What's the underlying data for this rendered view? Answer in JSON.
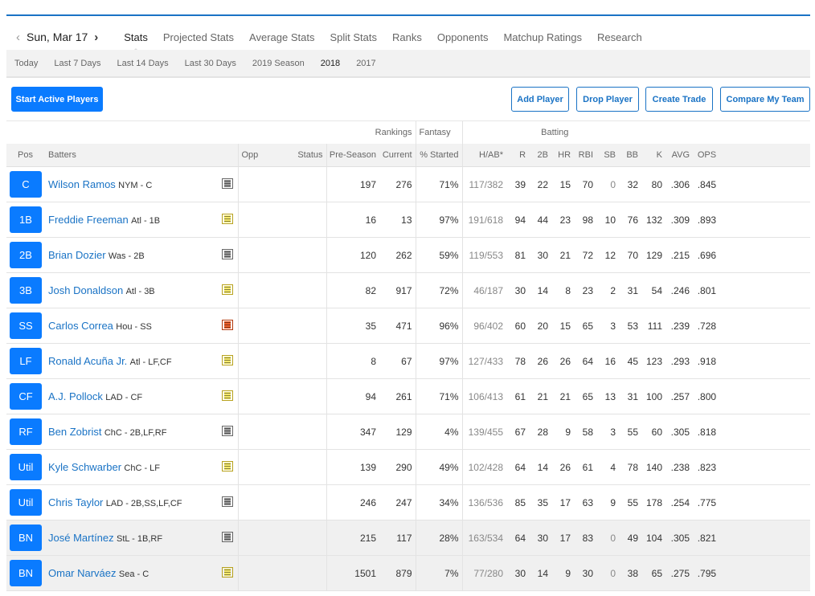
{
  "nav": {
    "date": "Sun, Mar 17",
    "tabs": [
      "Stats",
      "Projected Stats",
      "Average Stats",
      "Split Stats",
      "Ranks",
      "Opponents",
      "Matchup Ratings",
      "Research"
    ],
    "active_tab": "Stats"
  },
  "filters": {
    "items": [
      "Today",
      "Last 7 Days",
      "Last 14 Days",
      "Last 30 Days",
      "2019 Season",
      "2018",
      "2017"
    ],
    "active": "2018"
  },
  "buttons": {
    "start_active": "Start Active Players",
    "add_player": "Add Player",
    "drop_player": "Drop Player",
    "create_trade": "Create Trade",
    "compare": "Compare My Team"
  },
  "table": {
    "groups": {
      "rankings": "Rankings",
      "fantasy": "Fantasy",
      "batting": "Batting"
    },
    "columns": {
      "pos": "Pos",
      "batters": "Batters",
      "opp": "Opp",
      "status": "Status",
      "preseason": "Pre-Season",
      "current": "Current",
      "started": "% Started",
      "hab": "H/AB*",
      "r": "R",
      "d": "2B",
      "hr": "HR",
      "rbi": "RBI",
      "sb": "SB",
      "bb": "BB",
      "k": "K",
      "avg": "AVG",
      "ops": "OPS"
    },
    "rows": [
      {
        "pos": "C",
        "name": "Wilson Ramos",
        "team": "NYM - C",
        "note": "gray",
        "preseason": "197",
        "current": "276",
        "started": "71%",
        "hab": "117/382",
        "r": "39",
        "d": "22",
        "hr": "15",
        "rbi": "70",
        "sb": "0",
        "bb": "32",
        "k": "80",
        "avg": ".306",
        "ops": ".845"
      },
      {
        "pos": "1B",
        "name": "Freddie Freeman",
        "team": "Atl - 1B",
        "note": "yellow",
        "preseason": "16",
        "current": "13",
        "started": "97%",
        "hab": "191/618",
        "r": "94",
        "d": "44",
        "hr": "23",
        "rbi": "98",
        "sb": "10",
        "bb": "76",
        "k": "132",
        "avg": ".309",
        "ops": ".893"
      },
      {
        "pos": "2B",
        "name": "Brian Dozier",
        "team": "Was - 2B",
        "note": "gray",
        "preseason": "120",
        "current": "262",
        "started": "59%",
        "hab": "119/553",
        "r": "81",
        "d": "30",
        "hr": "21",
        "rbi": "72",
        "sb": "12",
        "bb": "70",
        "k": "129",
        "avg": ".215",
        "ops": ".696"
      },
      {
        "pos": "3B",
        "name": "Josh Donaldson",
        "team": "Atl - 3B",
        "note": "yellow",
        "preseason": "82",
        "current": "917",
        "started": "72%",
        "hab": "46/187",
        "r": "30",
        "d": "14",
        "hr": "8",
        "rbi": "23",
        "sb": "2",
        "bb": "31",
        "k": "54",
        "avg": ".246",
        "ops": ".801"
      },
      {
        "pos": "SS",
        "name": "Carlos Correa",
        "team": "Hou - SS",
        "note": "red",
        "preseason": "35",
        "current": "471",
        "started": "96%",
        "hab": "96/402",
        "r": "60",
        "d": "20",
        "hr": "15",
        "rbi": "65",
        "sb": "3",
        "bb": "53",
        "k": "111",
        "avg": ".239",
        "ops": ".728"
      },
      {
        "pos": "LF",
        "name": "Ronald Acuña Jr.",
        "team": "Atl - LF,CF",
        "note": "yellow",
        "preseason": "8",
        "current": "67",
        "started": "97%",
        "hab": "127/433",
        "r": "78",
        "d": "26",
        "hr": "26",
        "rbi": "64",
        "sb": "16",
        "bb": "45",
        "k": "123",
        "avg": ".293",
        "ops": ".918"
      },
      {
        "pos": "CF",
        "name": "A.J. Pollock",
        "team": "LAD - CF",
        "note": "yellow",
        "preseason": "94",
        "current": "261",
        "started": "71%",
        "hab": "106/413",
        "r": "61",
        "d": "21",
        "hr": "21",
        "rbi": "65",
        "sb": "13",
        "bb": "31",
        "k": "100",
        "avg": ".257",
        "ops": ".800"
      },
      {
        "pos": "RF",
        "name": "Ben Zobrist",
        "team": "ChC - 2B,LF,RF",
        "note": "gray",
        "preseason": "347",
        "current": "129",
        "started": "4%",
        "hab": "139/455",
        "r": "67",
        "d": "28",
        "hr": "9",
        "rbi": "58",
        "sb": "3",
        "bb": "55",
        "k": "60",
        "avg": ".305",
        "ops": ".818"
      },
      {
        "pos": "Util",
        "name": "Kyle Schwarber",
        "team": "ChC - LF",
        "note": "yellow",
        "preseason": "139",
        "current": "290",
        "started": "49%",
        "hab": "102/428",
        "r": "64",
        "d": "14",
        "hr": "26",
        "rbi": "61",
        "sb": "4",
        "bb": "78",
        "k": "140",
        "avg": ".238",
        "ops": ".823"
      },
      {
        "pos": "Util",
        "name": "Chris Taylor",
        "team": "LAD - 2B,SS,LF,CF",
        "note": "gray",
        "preseason": "246",
        "current": "247",
        "started": "34%",
        "hab": "136/536",
        "r": "85",
        "d": "35",
        "hr": "17",
        "rbi": "63",
        "sb": "9",
        "bb": "55",
        "k": "178",
        "avg": ".254",
        "ops": ".775"
      },
      {
        "pos": "BN",
        "name": "José Martínez",
        "team": "StL - 1B,RF",
        "note": "gray",
        "preseason": "215",
        "current": "117",
        "started": "28%",
        "hab": "163/534",
        "r": "64",
        "d": "30",
        "hr": "17",
        "rbi": "83",
        "sb": "0",
        "bb": "49",
        "k": "104",
        "avg": ".305",
        "ops": ".821"
      },
      {
        "pos": "BN",
        "name": "Omar Narváez",
        "team": "Sea - C",
        "note": "yellow",
        "preseason": "1501",
        "current": "879",
        "started": "7%",
        "hab": "77/280",
        "r": "30",
        "d": "14",
        "hr": "9",
        "rbi": "30",
        "sb": "0",
        "bb": "38",
        "k": "65",
        "avg": ".275",
        "ops": ".795"
      }
    ]
  }
}
